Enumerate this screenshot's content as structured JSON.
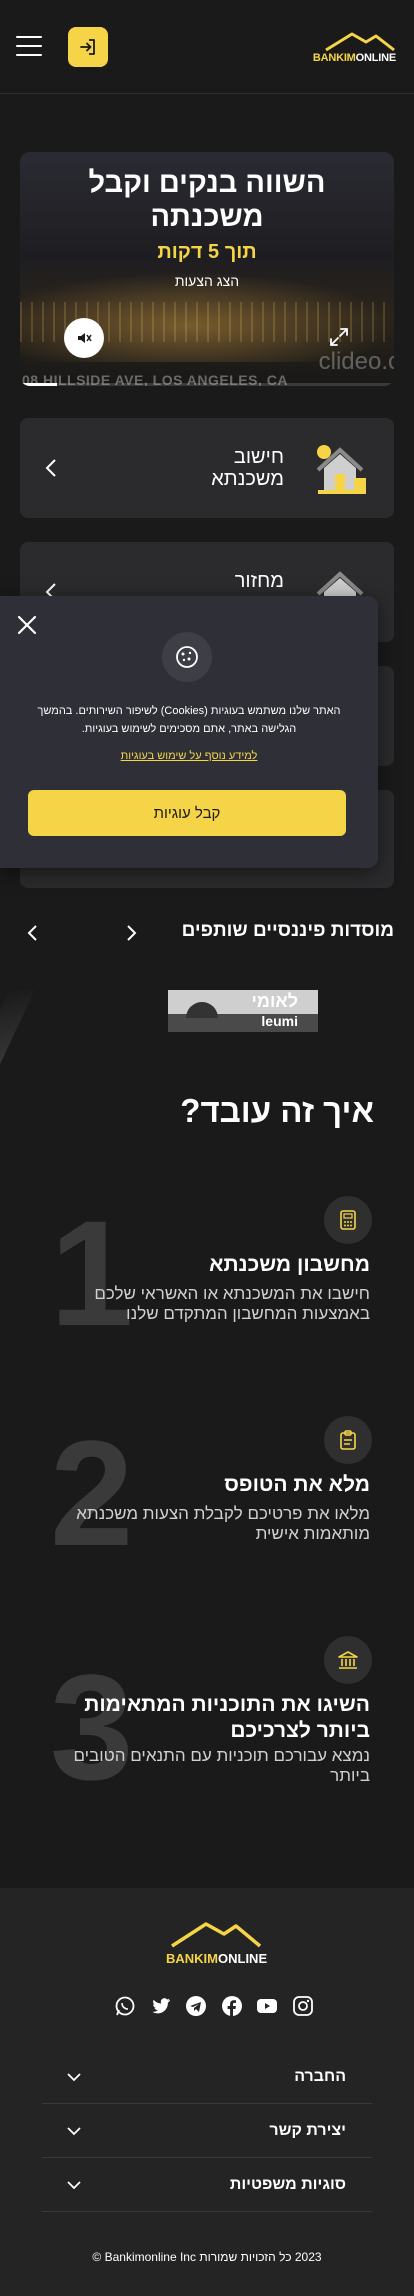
{
  "header": {
    "logo_text_accent": "BANKIM",
    "logo_text_rest": "ONLINE"
  },
  "hero": {
    "title": "השווה בנקים וקבל משכנתה",
    "subtitle": "תוך 5 דקות",
    "cta": "הצג הצעות",
    "watermark": "clideo.c",
    "caption": "08 HILLSIDE AVE, LOS ANGELES, CA",
    "video_progress": 0.1
  },
  "cards": [
    {
      "label_line1": "חישוב",
      "label_line2": "משכנתא"
    },
    {
      "label_line1": "מחזור",
      "label_line2": ""
    }
  ],
  "cookie": {
    "text": "האתר שלנו משתמש בעוגיות (Cookies) לשיפור השירותים. בהמשך הגלישה באתר, אתם מסכימים לשימוש בעוגיות.",
    "more_link": "למידע נוסף על שימוש בעוגיות",
    "accept_label": "קבל עוגיות"
  },
  "partners": {
    "title": "מוסדות פיננסיים שותפים",
    "bank_name_he": "לאומי",
    "bank_name_en": "leumi"
  },
  "how": {
    "title": "איך זה עובד?",
    "steps": [
      {
        "num": "1",
        "title": "מחשבון משכנתא",
        "desc_line1": "חישבו את המשכנתא או האשראי שלכם",
        "desc_line2": "באמצעות המחשבון המתקדם שלנו",
        "icon": "calculator-icon"
      },
      {
        "num": "2",
        "title": "מלא את הטופס",
        "desc_line1": "מלאו את פרטיכם לקבלת הצעות משכנתא",
        "desc_line2": "מותאמות אישית",
        "icon": "clipboard-icon"
      },
      {
        "num": "3",
        "title_line1": "השיגו את התוכניות המתאימות",
        "title_line2": "ביותר לצרכיכם",
        "desc_line1": "נמצא עבורכם תוכניות עם התנאים הטובים",
        "desc_line2": "ביותר",
        "icon": "bank-icon"
      }
    ]
  },
  "footer": {
    "logo_text_accent": "BANKIM",
    "logo_text_rest": "ONLINE",
    "social": [
      "whatsapp-icon",
      "twitter-icon",
      "telegram-icon",
      "facebook-icon",
      "youtube-icon",
      "instagram-icon"
    ],
    "accordion": [
      "החברה",
      "יצירת קשר",
      "סוגיות משפטיות"
    ],
    "copyright": "2023 כל הזכויות שמורות Bankimonline Inc ©"
  },
  "colors": {
    "accent": "#f5d547",
    "background": "#1a1a1a",
    "card": "#2b2b2d"
  }
}
